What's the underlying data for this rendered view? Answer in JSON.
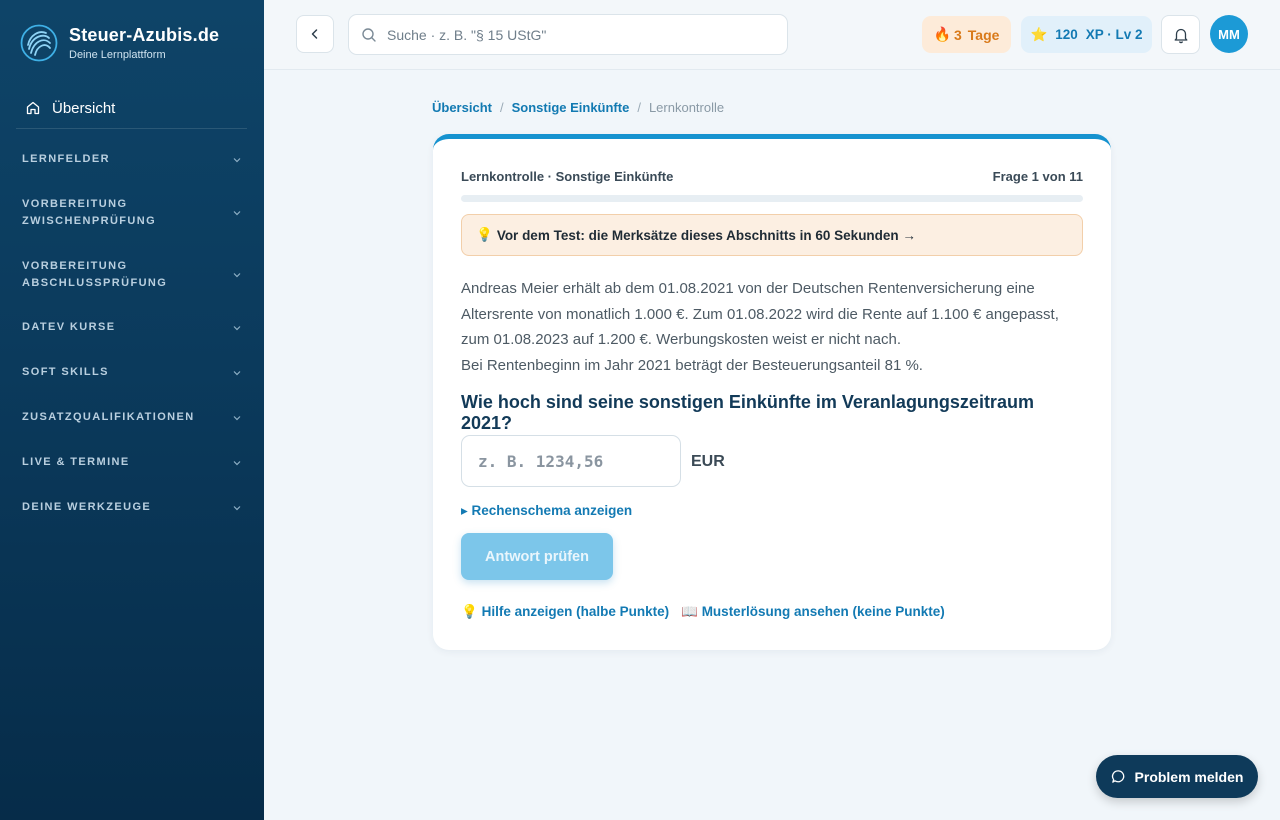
{
  "brand": {
    "title": "Steuer-Azubis.de",
    "subtitle": "Deine Lernplattform"
  },
  "sidebar": {
    "overview": "Übersicht",
    "groups": [
      {
        "label": "LERNFELDER"
      },
      {
        "label": "VORBEREITUNG ZWISCHENPRÜFUNG"
      },
      {
        "label": "VORBEREITUNG ABSCHLUSSPRÜFUNG"
      },
      {
        "label": "DATEV KURSE"
      },
      {
        "label": "SOFT SKILLS"
      },
      {
        "label": "ZUSATZQUALIFIKATIONEN"
      },
      {
        "label": "LIVE & TERMINE"
      },
      {
        "label": "DEINE WERKZEUGE"
      }
    ]
  },
  "header": {
    "search_placeholder": "Suche · z. B. \"§ 15 UStG\"",
    "streak_count": "3",
    "streak_label": "Tage",
    "xp_value": "120",
    "xp_label": "XP · Lv 2",
    "avatar_initials": "MM"
  },
  "breadcrumb": {
    "items": [
      "Übersicht",
      "Sonstige Einkünfte"
    ],
    "current": "Lernkontrolle"
  },
  "quiz": {
    "title": "Lernkontrolle · Sonstige Einkünfte",
    "counter": "Frage 1 von 11",
    "progress_fraction": 0.0,
    "tip": "Vor dem Test: die Merksätze dieses Abschnitts in 60 Sekunden →",
    "description_1": "Andreas Meier erhält ab dem 01.08.2021 von der Deutschen Rentenversicherung eine Altersrente von monatlich 1.000 €. Zum 01.08.2022 wird die Rente auf 1.100 € angepasst, zum 01.08.2023 auf 1.200 €. Werbungskosten weist er nicht nach.",
    "description_2": "Bei Rentenbeginn im Jahr 2021 beträgt der Besteuerungsanteil 81 %.",
    "question": "Wie hoch sind seine sonstigen Einkünfte im Veranlagungszeitraum 2021?",
    "answer_placeholder": "z. B. 1234,56",
    "answer_value": "",
    "unit": "EUR",
    "schema_link": "▸ Rechenschema anzeigen",
    "check_button": "Antwort prüfen",
    "help_link": "Hilfe anzeigen (halbe Punkte)",
    "solution_link": "Musterlösung ansehen (keine Punkte)"
  },
  "report_button": "Problem melden",
  "icons": {
    "bulb": "💡",
    "book": "📖",
    "flame": "🔥",
    "star": "⭐"
  },
  "colors": {
    "accent": "#1592cf",
    "sidebar": "#0b3a5c",
    "streak": "#d97a1a"
  }
}
